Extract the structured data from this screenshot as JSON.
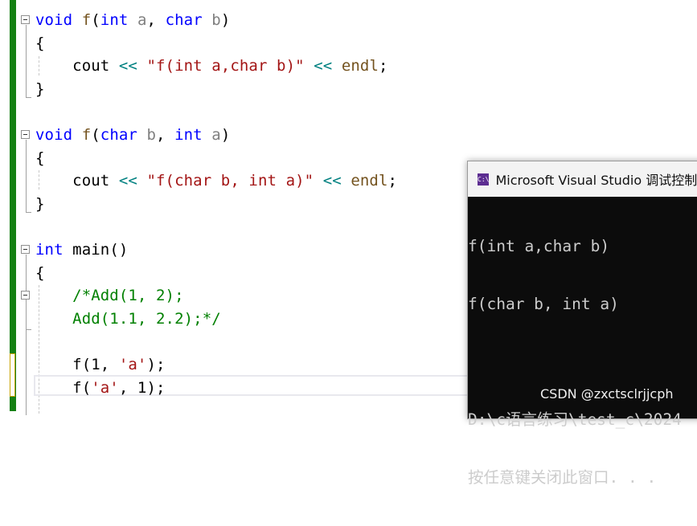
{
  "editor": {
    "lines": [
      [
        {
          "t": "void",
          "c": "kw"
        },
        {
          "t": " ",
          "c": "tx"
        },
        {
          "t": "f",
          "c": "fn"
        },
        {
          "t": "(",
          "c": "tx"
        },
        {
          "t": "int",
          "c": "kw"
        },
        {
          "t": " a",
          "c": "pm"
        },
        {
          "t": ", ",
          "c": "tx"
        },
        {
          "t": "char",
          "c": "kw"
        },
        {
          "t": " b",
          "c": "pm"
        },
        {
          "t": ")",
          "c": "tx"
        }
      ],
      [
        {
          "t": "{",
          "c": "tx"
        }
      ],
      [
        {
          "t": "    cout ",
          "c": "tx"
        },
        {
          "t": "<<",
          "c": "op"
        },
        {
          "t": " ",
          "c": "tx"
        },
        {
          "t": "\"f(int a,char b)\"",
          "c": "str"
        },
        {
          "t": " ",
          "c": "tx"
        },
        {
          "t": "<<",
          "c": "op"
        },
        {
          "t": " ",
          "c": "tx"
        },
        {
          "t": "endl",
          "c": "fn"
        },
        {
          "t": ";",
          "c": "tx"
        }
      ],
      [
        {
          "t": "}",
          "c": "tx"
        }
      ],
      [],
      [
        {
          "t": "void",
          "c": "kw"
        },
        {
          "t": " ",
          "c": "tx"
        },
        {
          "t": "f",
          "c": "fn"
        },
        {
          "t": "(",
          "c": "tx"
        },
        {
          "t": "char",
          "c": "kw"
        },
        {
          "t": " b",
          "c": "pm"
        },
        {
          "t": ", ",
          "c": "tx"
        },
        {
          "t": "int",
          "c": "kw"
        },
        {
          "t": " a",
          "c": "pm"
        },
        {
          "t": ")",
          "c": "tx"
        }
      ],
      [
        {
          "t": "{",
          "c": "tx"
        }
      ],
      [
        {
          "t": "    cout ",
          "c": "tx"
        },
        {
          "t": "<<",
          "c": "op"
        },
        {
          "t": " ",
          "c": "tx"
        },
        {
          "t": "\"f(char b, int a)\"",
          "c": "str"
        },
        {
          "t": " ",
          "c": "tx"
        },
        {
          "t": "<<",
          "c": "op"
        },
        {
          "t": " ",
          "c": "tx"
        },
        {
          "t": "endl",
          "c": "fn"
        },
        {
          "t": ";",
          "c": "tx"
        }
      ],
      [
        {
          "t": "}",
          "c": "tx"
        }
      ],
      [],
      [
        {
          "t": "int",
          "c": "kw"
        },
        {
          "t": " main()",
          "c": "tx"
        }
      ],
      [
        {
          "t": "{",
          "c": "tx"
        }
      ],
      [
        {
          "t": "    ",
          "c": "tx"
        },
        {
          "t": "/*Add(1, 2);",
          "c": "cm"
        }
      ],
      [
        {
          "t": "    ",
          "c": "tx"
        },
        {
          "t": "Add(1.1, 2.2);*/",
          "c": "cm"
        }
      ],
      [],
      [
        {
          "t": "    f(1, ",
          "c": "tx"
        },
        {
          "t": "'a'",
          "c": "ch"
        },
        {
          "t": ");",
          "c": "tx"
        }
      ],
      [
        {
          "t": "    f(",
          "c": "tx"
        },
        {
          "t": "'a'",
          "c": "ch"
        },
        {
          "t": ", 1);",
          "c": "tx"
        }
      ]
    ]
  },
  "console": {
    "title": "Microsoft Visual Studio 调试控制台",
    "icon": "console-app-icon",
    "icon_text": "C:\\",
    "output": [
      "f(int a,char b)",
      "f(char b, int a)",
      "",
      "D:\\c语言练习\\test_c\\2024",
      "按任意键关闭此窗口. . ."
    ]
  },
  "watermark": "CSDN @zxctsclrjjcph",
  "colors": {
    "keyword": "#0000ff",
    "string": "#a31515",
    "comment": "#008000",
    "change_bar": "#148012",
    "console_bg": "#0c0c0c"
  }
}
